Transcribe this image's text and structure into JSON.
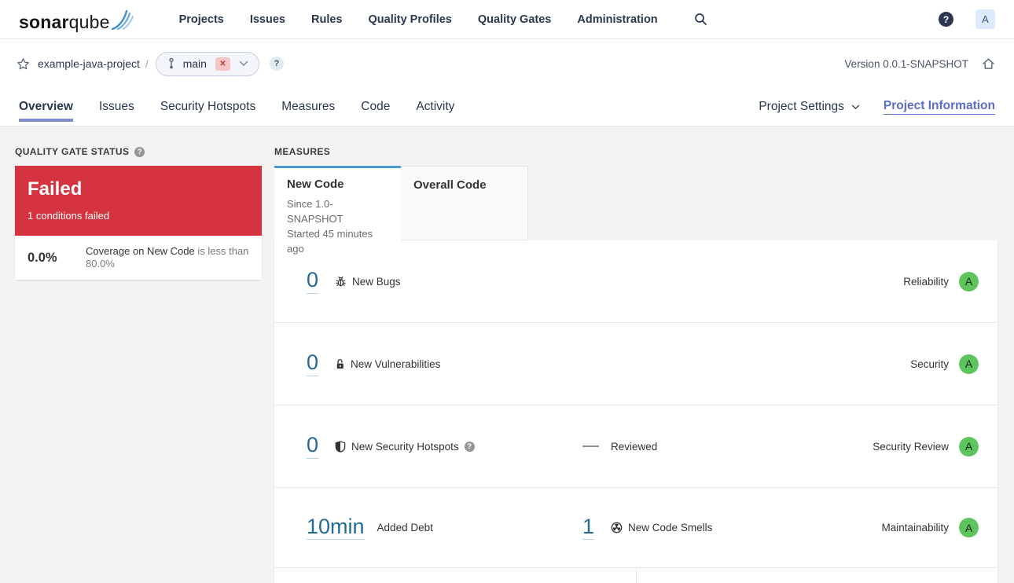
{
  "topnav": {
    "logo_bold": "sonar",
    "logo_light": "qube",
    "items": [
      "Projects",
      "Issues",
      "Rules",
      "Quality Profiles",
      "Quality Gates",
      "Administration"
    ],
    "help": "?",
    "avatar_initial": "A"
  },
  "breadcrumb": {
    "project": "example-java-project",
    "separator": "/",
    "branch_name": "main",
    "branch_close": "✕",
    "branch_help": "?",
    "version": "Version 0.0.1-SNAPSHOT"
  },
  "tabs": {
    "items": [
      "Overview",
      "Issues",
      "Security Hotspots",
      "Measures",
      "Code",
      "Activity"
    ],
    "active": "Overview",
    "project_settings": "Project Settings",
    "project_information": "Project Information"
  },
  "quality_gate": {
    "title": "QUALITY GATE STATUS",
    "help": "?",
    "status": "Failed",
    "conditions_summary": "1 conditions failed",
    "condition_value": "0.0%",
    "condition_metric": "Coverage on New Code",
    "condition_rule": "is less than 80.0%"
  },
  "measures": {
    "title": "MEASURES",
    "new_code_tab": {
      "label": "New Code",
      "since": "Since 1.0-SNAPSHOT",
      "started": "Started 45 minutes ago"
    },
    "overall_code_tab": {
      "label": "Overall Code"
    },
    "rows": [
      {
        "value": "0",
        "label": "New Bugs",
        "domain": "Reliability",
        "rating": "A"
      },
      {
        "value": "0",
        "label": "New Vulnerabilities",
        "domain": "Security",
        "rating": "A"
      },
      {
        "value": "0",
        "label": "New Security Hotspots",
        "help": "?",
        "reviewed_label": "Reviewed",
        "domain": "Security Review",
        "rating": "A"
      },
      {
        "value": "10min",
        "label": "Added Debt",
        "value2": "1",
        "label2": "New Code Smells",
        "domain": "Maintainability",
        "rating": "A"
      }
    ]
  },
  "colors": {
    "failed_red": "#d4333f",
    "rating_a_green": "#5ec45e",
    "link_blue": "#236a97",
    "new_code_tab_accent": "#4b9fd5",
    "active_tab_accent": "#7d89cf",
    "project_information_link": "#5b6cc9"
  }
}
